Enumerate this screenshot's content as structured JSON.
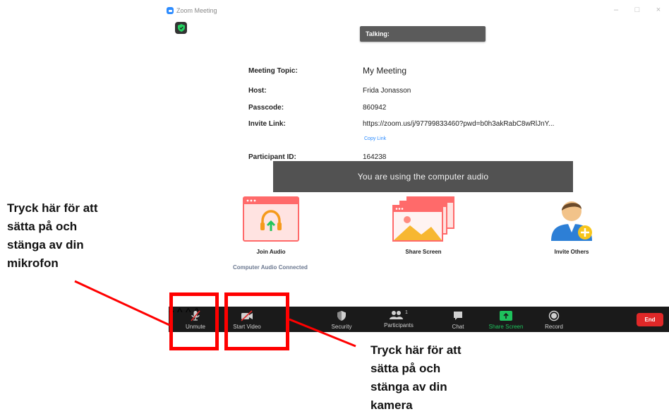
{
  "window": {
    "title": "Zoom Meeting",
    "controls": [
      "–",
      "□",
      "×"
    ]
  },
  "talking_label": "Talking:",
  "meeting_info": {
    "topic_label": "Meeting Topic:",
    "topic_value": "My Meeting",
    "host_label": "Host:",
    "host_value": "Frida Jonasson",
    "passcode_label": "Passcode:",
    "passcode_value": "860942",
    "invite_label": "Invite Link:",
    "invite_value": "https://zoom.us/j/97799833460?pwd=b0h3akRabC8wRlJnY...",
    "copy_link": "Copy Link",
    "participant_label": "Participant ID:",
    "participant_value": "164238"
  },
  "audio_banner": "You are using the computer audio",
  "actions": {
    "join_audio": "Join Audio",
    "share_screen": "Share Screen",
    "invite_others": "Invite Others",
    "audio_status": "Computer Audio Connected"
  },
  "toolbar": {
    "unmute": "Unmute",
    "start_video": "Start Video",
    "security": "Security",
    "participants": "Participants",
    "participant_count": "1",
    "chat": "Chat",
    "share_screen": "Share Screen",
    "record": "Record",
    "end": "End"
  },
  "annotations": {
    "mic_note": [
      "Tryck här för att",
      "sätta på och",
      "stänga av din",
      "mikrofon"
    ],
    "camera_note": [
      "Tryck här för att",
      "sätta på och",
      "stänga av din",
      "kamera"
    ]
  },
  "colors": {
    "accent": "#2d8cff",
    "share_green": "#1ec25c",
    "end_red": "#e02828",
    "annotation_red": "#ff0000"
  }
}
